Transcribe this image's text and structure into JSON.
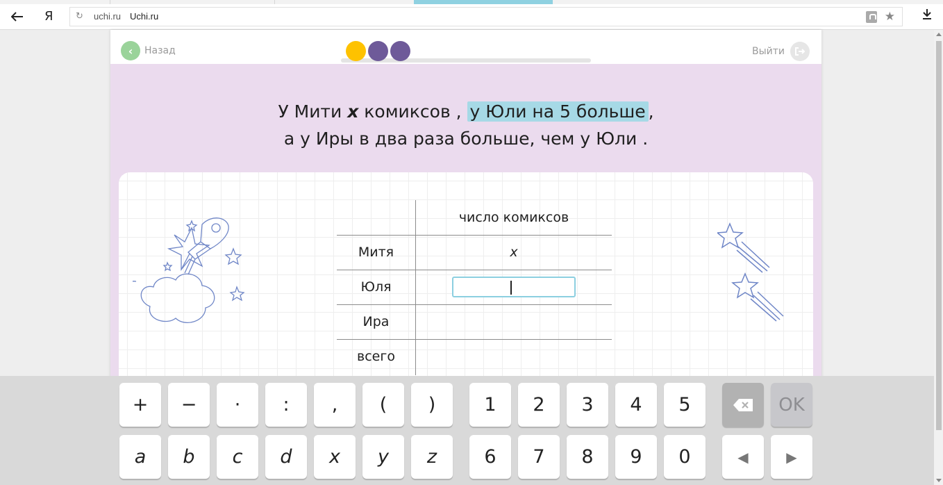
{
  "browser": {
    "logo": "Я",
    "url_domain": "uchi.ru",
    "page_title": "Uchi.ru",
    "icons": [
      "back-arrow-icon",
      "reload-icon",
      "lock-icon",
      "star-icon",
      "download-icon"
    ]
  },
  "header": {
    "back_label": "Назад",
    "exit_label": "Выйти",
    "progress_dots": [
      {
        "state": "current",
        "color": "#fec200"
      },
      {
        "state": "pending",
        "color": "#6e5a99"
      },
      {
        "state": "pending",
        "color": "#6e5a99"
      }
    ]
  },
  "problem": {
    "line1_a": "У Мити",
    "line1_var": "x",
    "line1_b": "комиксов ,",
    "line1_highlight": "у Юли на 5 больше",
    "line1_end": ",",
    "line2": "а у Иры в два раза больше, чем у Юли ."
  },
  "table": {
    "column_header": "число комиксов",
    "rows": [
      {
        "name": "Митя",
        "value": "x"
      },
      {
        "name": "Юля",
        "value": ""
      },
      {
        "name": "Ира",
        "value": ""
      },
      {
        "name": "всего",
        "value": ""
      }
    ]
  },
  "keyboard": {
    "row1_ops": [
      "+",
      "−",
      "·",
      ":",
      ",",
      "(",
      ")"
    ],
    "row1_digits": [
      "1",
      "2",
      "3",
      "4",
      "5"
    ],
    "row2_letters": [
      "a",
      "b",
      "c",
      "d",
      "x",
      "y",
      "z"
    ],
    "row2_digits": [
      "6",
      "7",
      "8",
      "9",
      "0"
    ],
    "ok_label": "OK",
    "left_arrow": "◀",
    "right_arrow": "▶"
  },
  "colors": {
    "accent_highlight": "#a6d9e6",
    "page_bg": "#ebdbee",
    "back_button": "#9ad39a"
  }
}
